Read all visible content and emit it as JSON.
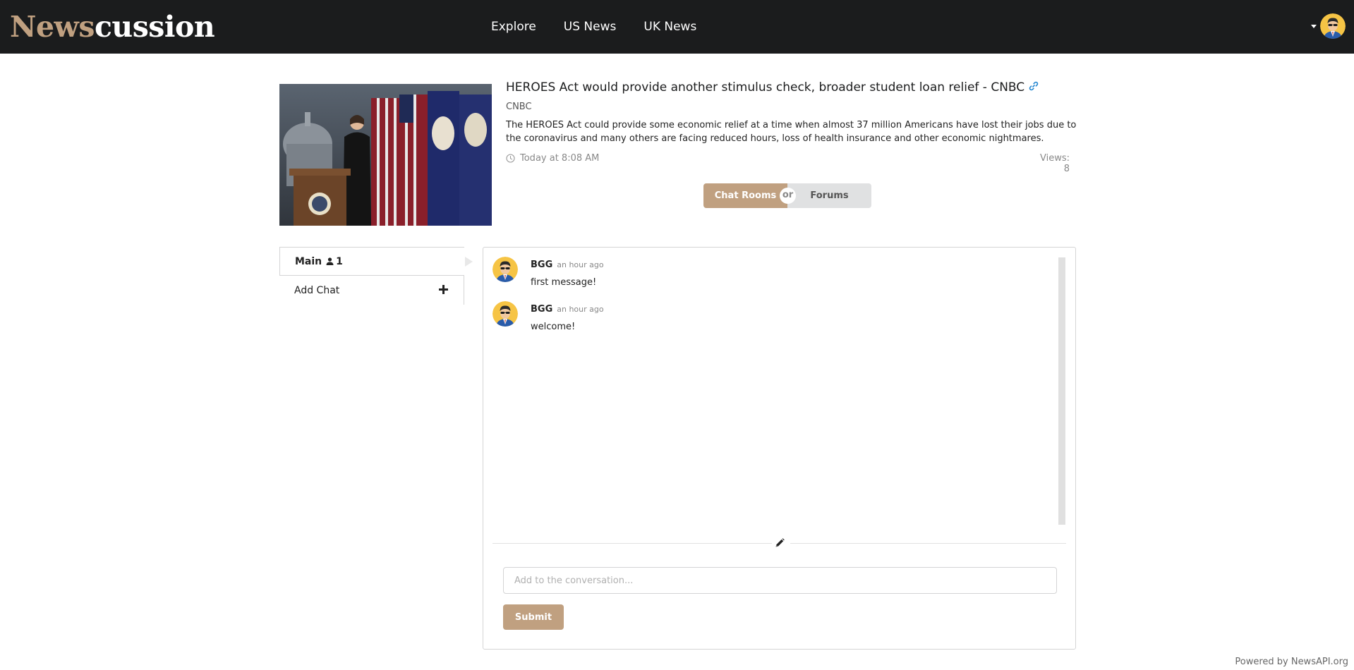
{
  "nav": {
    "brand_part1": "News",
    "brand_part2": "cussion",
    "links": [
      "Explore",
      "US News",
      "UK News"
    ]
  },
  "article": {
    "title": "HEROES Act would provide another stimulus check, broader student loan relief - CNBC",
    "source": "CNBC",
    "description": "The HEROES Act could provide some economic relief at a time when almost 37 million Americans have lost their jobs due to the coronavirus and many others are facing reduced hours, loss of health insurance and other economic nightmares.",
    "time": "Today at 8:08 AM",
    "views": "Views: 8"
  },
  "toggle": {
    "chat_label": "Chat Rooms",
    "or_label": "or",
    "forum_label": "Forums"
  },
  "rooms": [
    {
      "name": "Main",
      "count": "1"
    },
    {
      "name": "Add Chat"
    }
  ],
  "chat": {
    "messages": [
      {
        "author": "BGG",
        "time": "an hour ago",
        "text": "first message!"
      },
      {
        "author": "BGG",
        "time": "an hour ago",
        "text": "welcome!"
      }
    ],
    "input_placeholder": "Add to the conversation...",
    "submit_label": "Submit"
  },
  "footer": {
    "powered_by": "Powered by NewsAPI.org"
  },
  "colors": {
    "accent": "#c0a080",
    "navbar": "#1b1c1d",
    "link": "#2185d0"
  }
}
